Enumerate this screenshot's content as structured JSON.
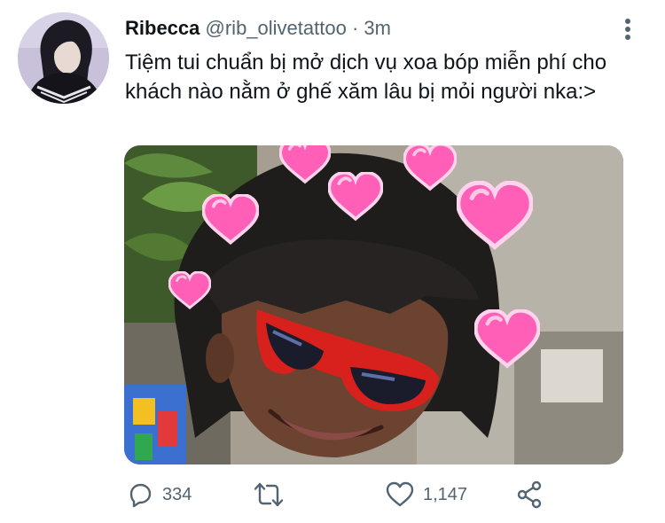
{
  "tweet": {
    "display_name": "Ribecca",
    "handle": "@rib_olivetattoo",
    "separator": "·",
    "time": "3m",
    "text": "Tiệm tui chuẩn bị mở dịch vụ xoa bóp miễn phí cho khách nào nằm ở ghế xăm lâu bị mỏi người nka:>"
  },
  "actions": {
    "reply_count": "334",
    "retweet_count": "",
    "like_count": "1,147"
  },
  "icons": [
    "more-icon",
    "reply-icon",
    "retweet-icon",
    "like-icon",
    "share-icon"
  ],
  "colors": {
    "text": "#0f1419",
    "secondary": "#536471",
    "heart": "#ff5fb6"
  }
}
